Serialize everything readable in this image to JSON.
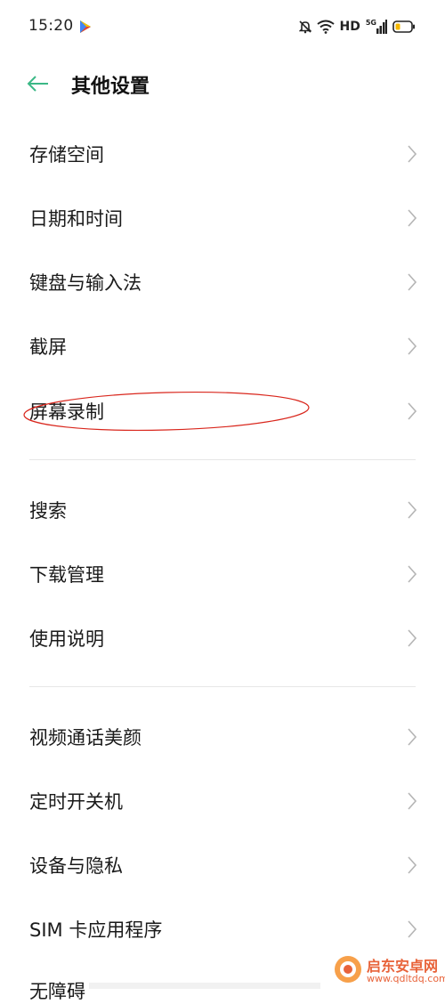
{
  "status_bar": {
    "time": "15:20",
    "network": "HD",
    "signal_type": "5G",
    "icons": [
      "play-store-icon",
      "mute-bell-icon",
      "wifi-icon",
      "signal-icon",
      "battery-icon"
    ]
  },
  "header": {
    "title": "其他设置",
    "back_icon": "arrow-left-icon",
    "accent_color": "#3bb886"
  },
  "groups": [
    {
      "items": [
        {
          "label": "存储空间"
        },
        {
          "label": "日期和时间"
        },
        {
          "label": "键盘与输入法"
        },
        {
          "label": "截屏"
        },
        {
          "label": "屏幕录制"
        }
      ]
    },
    {
      "items": [
        {
          "label": "搜索"
        },
        {
          "label": "下载管理"
        },
        {
          "label": "使用说明"
        }
      ]
    },
    {
      "items": [
        {
          "label": "视频通话美颜"
        },
        {
          "label": "定时开关机"
        },
        {
          "label": "设备与隐私"
        },
        {
          "label": "SIM 卡应用程序"
        }
      ]
    }
  ],
  "partial_row": {
    "label": "无障碍"
  },
  "annotation": {
    "color": "#d9261c",
    "highlighted_item": "屏幕录制"
  },
  "watermark": {
    "title": "启东安卓网",
    "url": "www.qdltdq.com"
  }
}
